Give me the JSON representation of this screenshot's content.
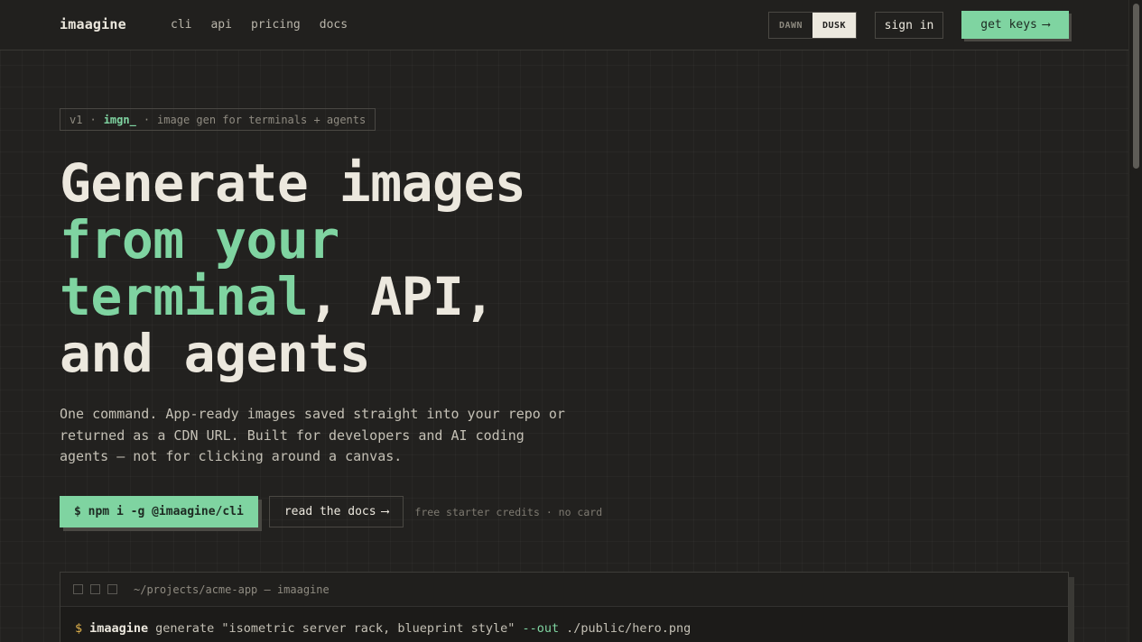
{
  "header": {
    "logo": "imaagine",
    "nav": [
      "cli",
      "api",
      "pricing",
      "docs"
    ],
    "theme": {
      "dawn": "DAWN",
      "dusk": "DUSK",
      "selected": "DUSK"
    },
    "sign_in": "sign in",
    "get_keys": "get keys",
    "get_keys_arrow": "⟶"
  },
  "hero": {
    "tagline_version": "v1",
    "tagline_sep": "·",
    "tagline_cmd": "imgn_",
    "tagline_text": "image gen for terminals + agents",
    "headline": {
      "line1": "Generate images",
      "line2_accent": "from your",
      "line3_accent": "terminal",
      "line3_rest": ", API,",
      "line4": "and agents"
    },
    "lede": "One command. App-ready images saved straight into your repo or returned as a CDN URL. Built for developers and AI coding agents — not for clicking around a canvas.",
    "install_button": "$ npm i -g @imaagine/cli",
    "docs_button": "read the docs",
    "docs_arrow": "⟶",
    "cta_note": "free starter credits · no card"
  },
  "terminal": {
    "title": "~/projects/acme-app — imaagine",
    "prompt": "$",
    "command": "imaagine",
    "args": "generate \"isometric server rack, blueprint style\"",
    "flag": "--out",
    "path": "./public/hero.png"
  },
  "colors": {
    "accent": "#7fd4a1",
    "background": "#22211f",
    "text": "#ece8de",
    "prompt": "#e0b24c"
  }
}
